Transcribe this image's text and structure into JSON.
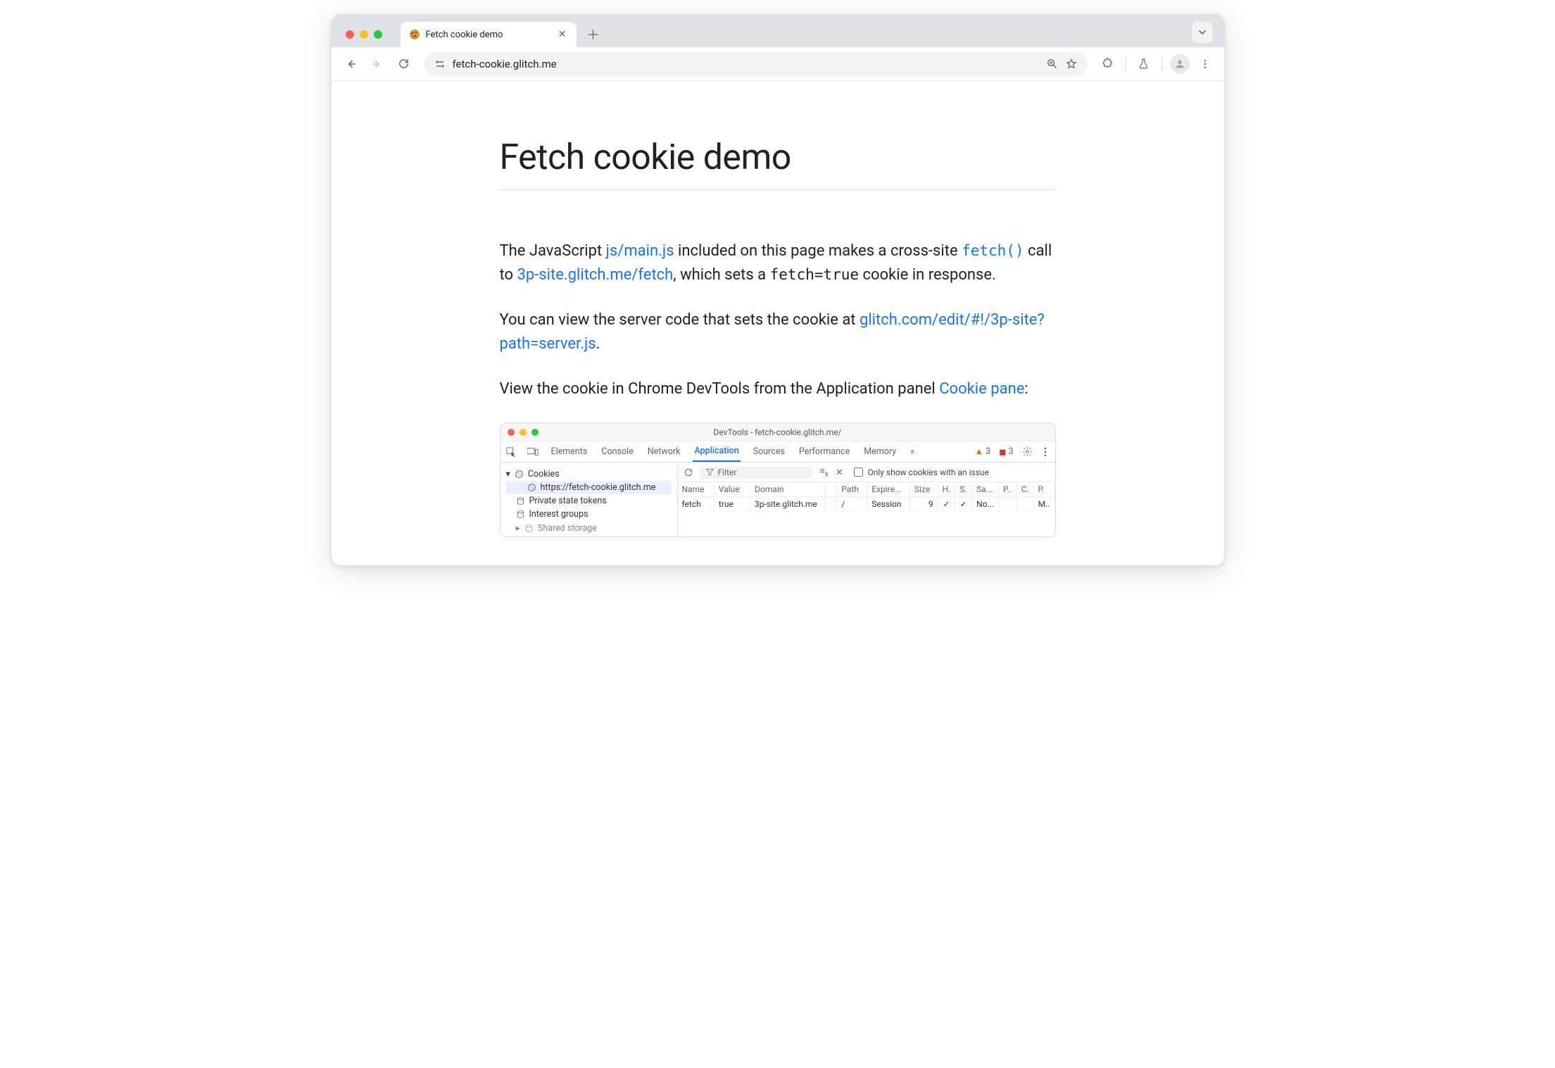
{
  "browser": {
    "tab": {
      "title": "Fetch cookie demo"
    },
    "omnibox": {
      "url": "fetch-cookie.glitch.me"
    }
  },
  "page": {
    "heading": "Fetch cookie demo",
    "p1_a": "The JavaScript ",
    "p1_link1": "js/main.js",
    "p1_b": " included on this page makes a cross-site ",
    "p1_code_link": "fetch()",
    "p1_c": " call to ",
    "p1_link2": "3p-site.glitch.me/fetch",
    "p1_d": ", which sets a ",
    "p1_code": "fetch=true",
    "p1_e": " cookie in response.",
    "p2_a": "You can view the server code that sets the cookie at ",
    "p2_link": "glitch.com/edit/#!/3p-site?path=server.js",
    "p2_b": ".",
    "p3_a": "View the cookie in Chrome DevTools from the Application panel ",
    "p3_link": "Cookie pane",
    "p3_b": ":"
  },
  "devtools": {
    "title": "DevTools - fetch-cookie.glitch.me/",
    "tabs": [
      "Elements",
      "Console",
      "Network",
      "Application",
      "Sources",
      "Performance",
      "Memory"
    ],
    "active_tab": "Application",
    "warn_count": "3",
    "issue_count": "3",
    "sidebar": {
      "cookies_label": "Cookies",
      "cookie_origin": "https://fetch-cookie.glitch.me",
      "private_state": "Private state tokens",
      "interest_groups": "Interest groups",
      "shared_storage": "Shared storage"
    },
    "toolbar": {
      "filter_placeholder": "Filter",
      "only_issue": "Only show cookies with an issue"
    },
    "columns": [
      "Name",
      "Value",
      "Domain",
      "",
      "Path",
      "Expire...",
      "Size",
      "H.",
      "S.",
      "Sa...",
      "P..",
      "C.",
      "P."
    ],
    "row": {
      "name": "fetch",
      "value": "true",
      "domain": "3p-site.glitch.me",
      "arrow": "▲",
      "path": "/",
      "expires": "Session",
      "size": "9",
      "http": "✓",
      "secure": "✓",
      "samesite": "No...",
      "partition": "",
      "cross": "",
      "priority": "M.."
    }
  }
}
